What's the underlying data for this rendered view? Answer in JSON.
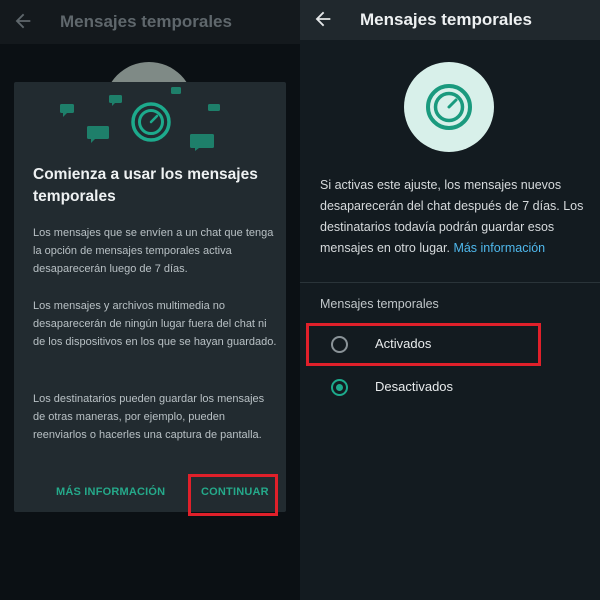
{
  "left": {
    "app_title": "Mensajes temporales",
    "dialog": {
      "title": "Comienza a usar los mensajes temporales",
      "paragraphs": [
        "Los mensajes que se envíen a un chat que tenga la opción de mensajes temporales activa desaparecerán luego de 7 días.",
        "Los mensajes y archivos multimedia no desaparecerán de ningún lugar fuera del chat ni de los dispositivos en los que se hayan guardado.",
        "Los destinatarios pueden guardar los mensajes de otras maneras, por ejemplo, pueden reenviarlos o hacerles una captura de pantalla."
      ],
      "more_info_label": "MÁS INFORMACIÓN",
      "continue_label": "CONTINUAR"
    }
  },
  "right": {
    "app_title": "Mensajes temporales",
    "description": "Si activas este ajuste, los mensajes nuevos desaparecerán del chat después de 7 días. Los destinatarios todavía podrán guardar esos mensajes en otro lugar.",
    "link_text": "Más información",
    "section_label": "Mensajes temporales",
    "options": [
      {
        "label": "Activados",
        "selected": false
      },
      {
        "label": "Desactivados",
        "selected": true
      }
    ]
  },
  "colors": {
    "accent": "#25a98a",
    "link": "#4fb8ec",
    "highlight": "#e0202a",
    "dialog_bg": "#222b30",
    "panel_bg": "#131b20"
  },
  "icons": {
    "back": "arrow-left-icon",
    "timer": "stopwatch-icon",
    "message": "chat-bubble-icon"
  }
}
